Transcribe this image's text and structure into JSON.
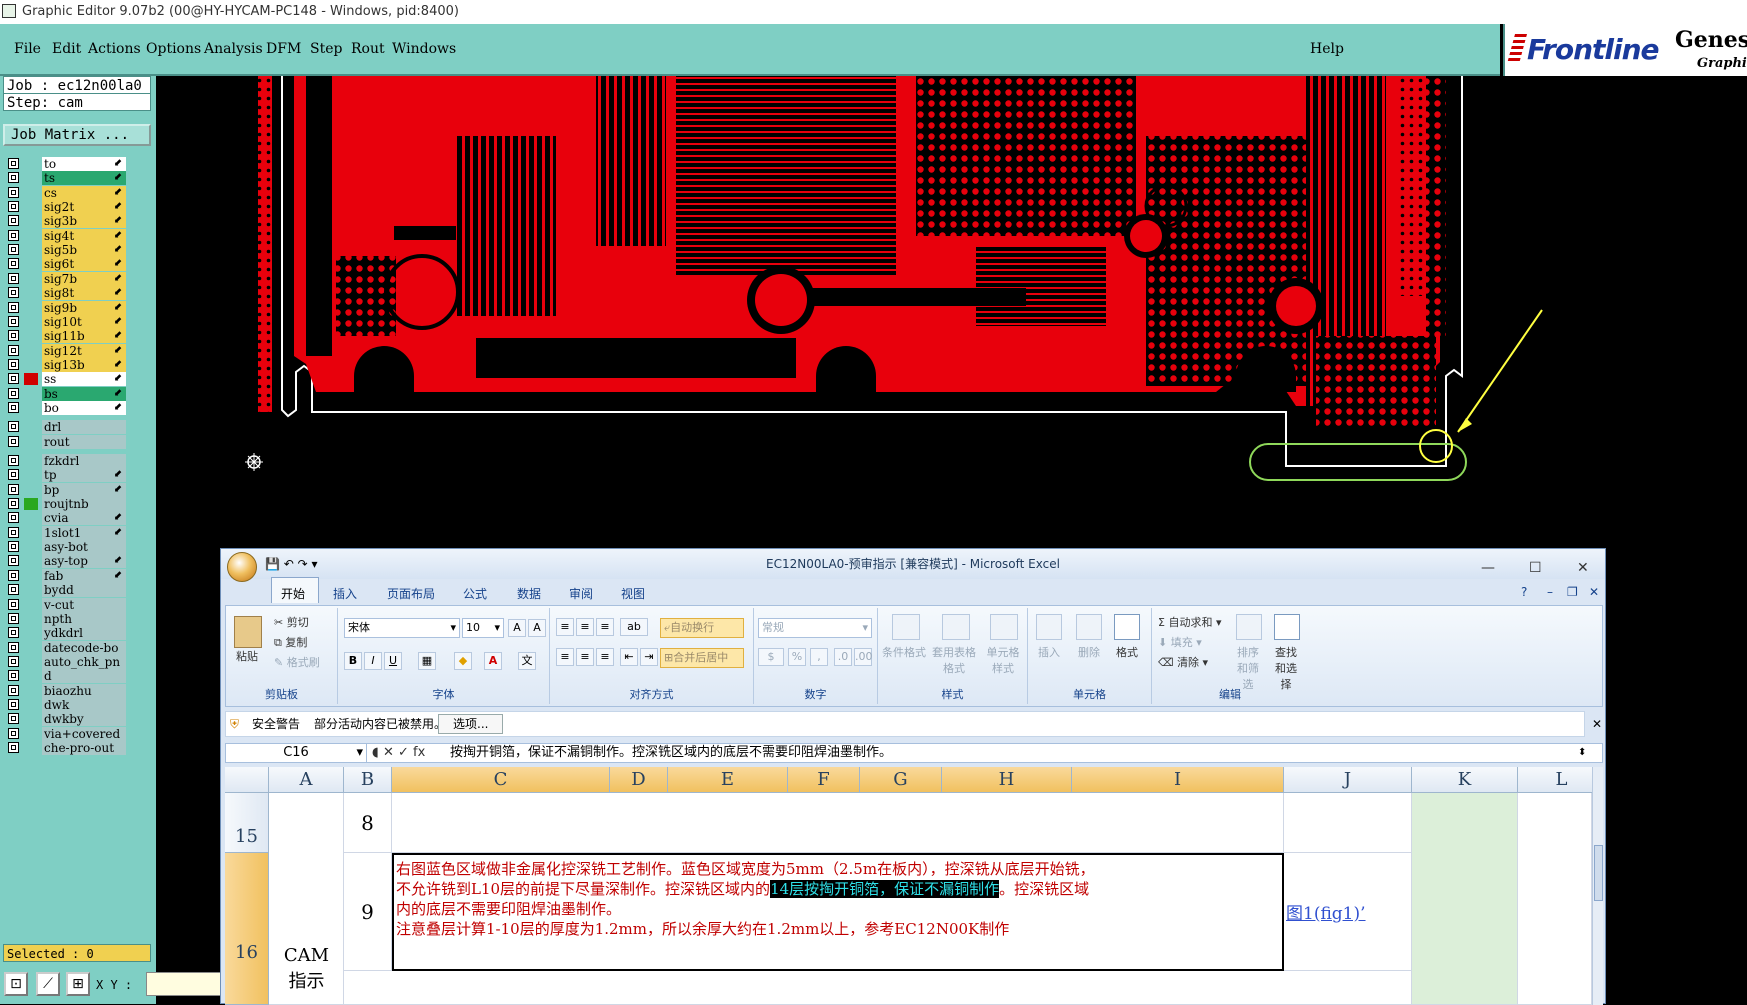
{
  "window_title": "Graphic Editor 9.07b2 (00@HY-HYCAM-PC148 - Windows, pid:8400)",
  "menu": {
    "items": [
      "File",
      "Edit",
      "Actions",
      "Options",
      "Analysis",
      "DFM",
      "Step",
      "Rout",
      "Windows"
    ],
    "help": "Help"
  },
  "brand": {
    "logo": "Frontline",
    "product": "Genesis",
    "sub": "Graphic"
  },
  "job": {
    "job_line": "Job : ec12n00la0",
    "step_line": "Step: cam",
    "matrix_button": "Job Matrix ..."
  },
  "layers": [
    {
      "name": "to",
      "bg": "#ffffff"
    },
    {
      "name": "ts",
      "bg": "#2aa870"
    },
    {
      "name": "cs",
      "bg": "#f0d050"
    },
    {
      "name": "sig2t",
      "bg": "#f0d050"
    },
    {
      "name": "sig3b",
      "bg": "#f0d050"
    },
    {
      "name": "sig4t",
      "bg": "#f0d050"
    },
    {
      "name": "sig5b",
      "bg": "#f0d050"
    },
    {
      "name": "sig6t",
      "bg": "#f0d050"
    },
    {
      "name": "sig7b",
      "bg": "#f0d050"
    },
    {
      "name": "sig8t",
      "bg": "#f0d050"
    },
    {
      "name": "sig9b",
      "bg": "#f0d050"
    },
    {
      "name": "sig10t",
      "bg": "#f0d050"
    },
    {
      "name": "sig11b",
      "bg": "#f0d050"
    },
    {
      "name": "sig12t",
      "bg": "#f0d050"
    },
    {
      "name": "sig13b",
      "bg": "#f0d050"
    },
    {
      "name": "ss",
      "bg": "#ffffff"
    },
    {
      "name": "bs",
      "bg": "#2aa870"
    },
    {
      "name": "bo",
      "bg": "#ffffff"
    },
    {
      "name": "drl",
      "bg": "#a8c8c8"
    },
    {
      "name": "rout",
      "bg": "#a8c8c8"
    },
    {
      "name": "fzkdrl",
      "bg": "#a8c8c8"
    },
    {
      "name": "tp",
      "bg": "#a8c8c8"
    },
    {
      "name": "bp",
      "bg": "#a8c8c8"
    },
    {
      "name": "roujtnb",
      "bg": "#a8c8c8"
    },
    {
      "name": "cvia",
      "bg": "#a8c8c8"
    },
    {
      "name": "1slot1",
      "bg": "#a8c8c8"
    },
    {
      "name": "asy-bot",
      "bg": "#a8c8c8"
    },
    {
      "name": "asy-top",
      "bg": "#a8c8c8"
    },
    {
      "name": "fab",
      "bg": "#a8c8c8"
    },
    {
      "name": "bydd",
      "bg": "#a8c8c8"
    },
    {
      "name": "v-cut",
      "bg": "#a8c8c8"
    },
    {
      "name": "npth",
      "bg": "#a8c8c8"
    },
    {
      "name": "ydkdrl",
      "bg": "#a8c8c8"
    },
    {
      "name": "datecode-bo",
      "bg": "#a8c8c8"
    },
    {
      "name": "auto_chk_pn",
      "bg": "#a8c8c8"
    },
    {
      "name": "d",
      "bg": "#a8c8c8"
    },
    {
      "name": "biaozhu",
      "bg": "#a8c8c8"
    },
    {
      "name": "dwk",
      "bg": "#a8c8c8"
    },
    {
      "name": "dwkby",
      "bg": "#a8c8c8"
    },
    {
      "name": "via+covered",
      "bg": "#a8c8c8"
    },
    {
      "name": "che-pro-out",
      "bg": "#a8c8c8"
    }
  ],
  "status": {
    "selected": "Selected : 0",
    "xy_label": "X Y :"
  },
  "excel": {
    "title": "EC12N00LA0-预审指示 [兼容模式] - Microsoft Excel",
    "tabs": [
      "开始",
      "插入",
      "页面布局",
      "公式",
      "数据",
      "审阅",
      "视图"
    ],
    "ribbon": {
      "clipboard": {
        "paste": "粘贴",
        "cut": "剪切",
        "copy": "复制",
        "format_painter": "格式刷",
        "group": "剪贴板"
      },
      "font": {
        "name": "宋体",
        "size": "10",
        "group": "字体"
      },
      "alignment": {
        "wrap": "自动换行",
        "merge": "合并后居中",
        "group": "对齐方式"
      },
      "number": {
        "format": "常规",
        "group": "数字"
      },
      "styles": {
        "conditional": "条件格式",
        "table": "套用表格格式",
        "cell": "单元格样式",
        "group": "样式"
      },
      "cells": {
        "insert": "插入",
        "delete": "删除",
        "format": "格式",
        "group": "单元格"
      },
      "editing": {
        "autosum": "自动求和",
        "fill": "填充",
        "clear": "清除",
        "sort": "排序和筛选",
        "find": "查找和选择",
        "group": "编辑"
      }
    },
    "security": {
      "label": "安全警告",
      "message": "部分活动内容已被禁用。",
      "button": "选项..."
    },
    "formula_bar": {
      "cell_ref": "C16",
      "content": "按掏开铜箔，保证不漏铜制作。控深铣区域内的底层不需要印阻焊油墨制作。"
    },
    "columns": [
      "A",
      "B",
      "C",
      "D",
      "E",
      "F",
      "G",
      "H",
      "I",
      "J",
      "K",
      "L"
    ],
    "rows": [
      {
        "num": "15",
        "b": "8",
        "c_lines": []
      },
      {
        "num": "16",
        "b": "9",
        "a": "CAM",
        "a2": "指示",
        "c_line1": "右图蓝色区域做非金属化控深铣工艺制作。蓝色区域宽度为5mm（2.5m在板内），控深铣从底层开始铣，",
        "c_line2_pre": "不允许铣到L10层的前提下尽量深制作。控深铣区域内的",
        "c_line2_hl": "14层按掏开铜箔，保证不漏铜制作",
        "c_line2_post": "。控深铣区域",
        "c_line3": "内的底层不需要印阻焊油墨制作。",
        "c_line4": "注意叠层计算1-10层的厚度为1.2mm，所以余厚大约在1.2mm以上，参考EC12N00K制作",
        "j": "图1(fig1)’"
      }
    ]
  }
}
